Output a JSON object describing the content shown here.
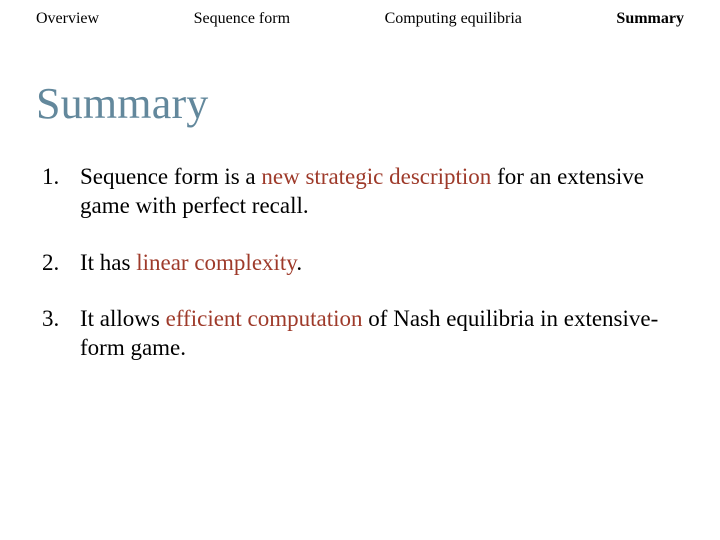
{
  "nav": {
    "items": [
      {
        "label": "Overview",
        "active": false
      },
      {
        "label": "Sequence form",
        "active": false
      },
      {
        "label": "Computing equilibria",
        "active": false
      },
      {
        "label": "Summary",
        "active": true
      }
    ]
  },
  "title": "Summary",
  "points": [
    {
      "num": "1.",
      "segments": [
        {
          "text": "Sequence form is a "
        },
        {
          "text": "new strategic description",
          "accent": true
        },
        {
          "text": " for an extensive game with perfect recall."
        }
      ]
    },
    {
      "num": "2.",
      "segments": [
        {
          "text": "It has "
        },
        {
          "text": "linear complexity",
          "accent": true
        },
        {
          "text": "."
        }
      ]
    },
    {
      "num": "3.",
      "segments": [
        {
          "text": "It allows "
        },
        {
          "text": "efficient computation",
          "accent": true
        },
        {
          "text": " of Nash equilibria in extensive-form game."
        }
      ]
    }
  ]
}
